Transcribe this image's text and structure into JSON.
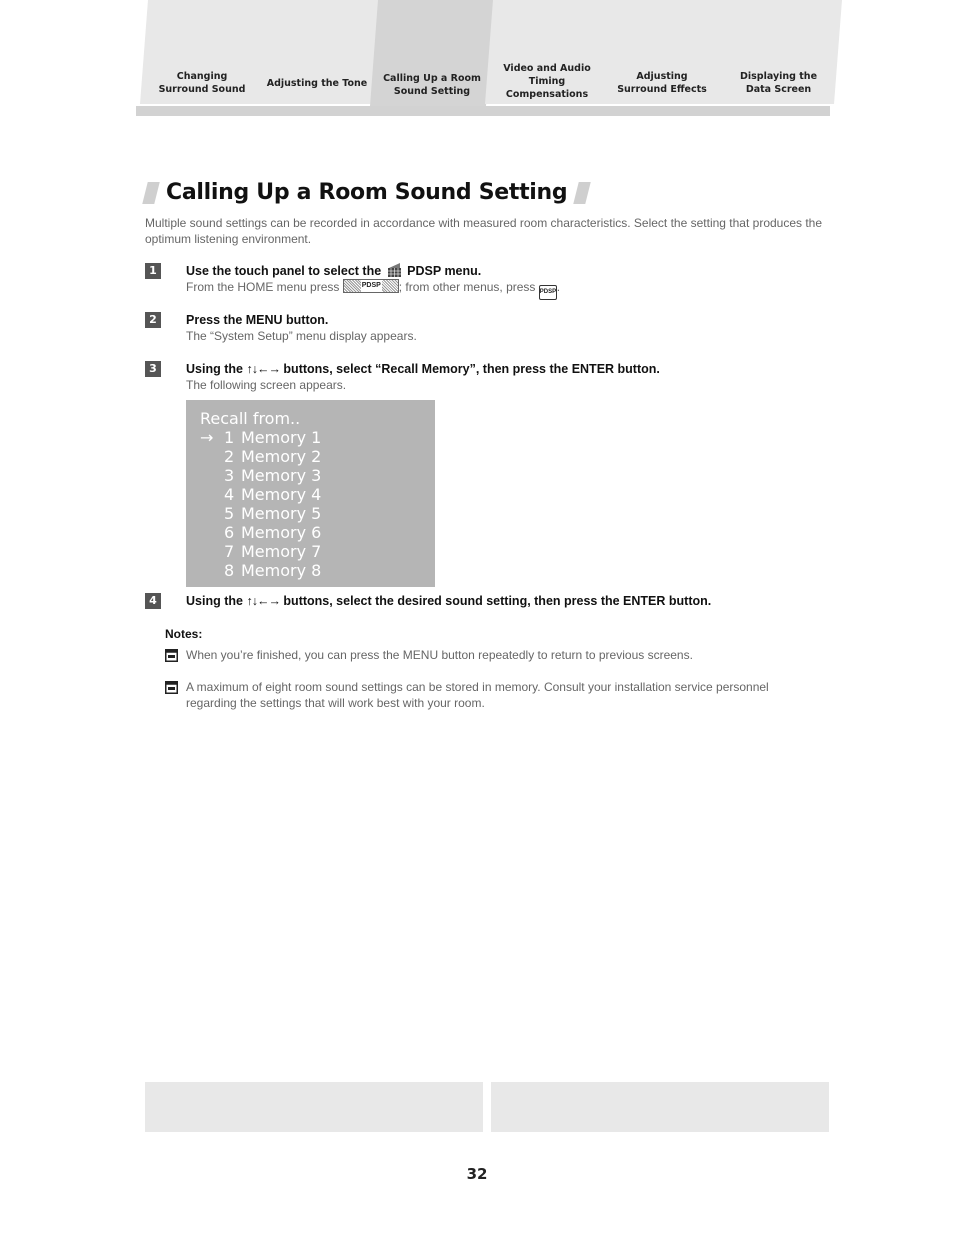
{
  "tabs": [
    {
      "label": "Changing\nSurround Sound",
      "active": false
    },
    {
      "label": "Adjusting the Tone",
      "active": false
    },
    {
      "label": "Calling Up a Room\nSound Setting",
      "active": true
    },
    {
      "label": "Video and Audio\nTiming\nCompensations",
      "active": false
    },
    {
      "label": "Adjusting\nSurround Effects",
      "active": false
    },
    {
      "label": "Displaying the\nData Screen",
      "active": false
    }
  ],
  "heading": "Calling Up a Room Sound Setting",
  "intro": "Multiple sound settings can be recorded in accordance with measured room characteristics. Select the setting that produces the optimum listening environment.",
  "steps": [
    {
      "number": "1",
      "title_pre": "Use the touch panel to select the",
      "title_post": "PDSP menu.",
      "sub_pre": "From the HOME menu press",
      "sub_mid": "; from other menus, press",
      "sub_post": ".",
      "button_wide_label": "PDSP",
      "button_small_label": "PDSP"
    },
    {
      "number": "2",
      "title": "Press the MENU button.",
      "sub": "The “System Setup” menu display appears."
    },
    {
      "number": "3",
      "title_pre": "Using the",
      "arrows": "↑↓←→",
      "title_post": "buttons, select “Recall Memory”, then press the ENTER button.",
      "sub": "The following screen appears."
    },
    {
      "number": "4",
      "title_pre": "Using the",
      "arrows": "↑↓←→",
      "title_post": "buttons, select the desired sound setting, then press the ENTER button."
    }
  ],
  "screen": {
    "title": "Recall from..",
    "cursor": "→",
    "items": [
      {
        "num": "1",
        "label": "Memory 1",
        "selected": true
      },
      {
        "num": "2",
        "label": "Memory 2",
        "selected": false
      },
      {
        "num": "3",
        "label": "Memory 3",
        "selected": false
      },
      {
        "num": "4",
        "label": "Memory 4",
        "selected": false
      },
      {
        "num": "5",
        "label": "Memory 5",
        "selected": false
      },
      {
        "num": "6",
        "label": "Memory 6",
        "selected": false
      },
      {
        "num": "7",
        "label": "Memory 7",
        "selected": false
      },
      {
        "num": "8",
        "label": "Memory 8",
        "selected": false
      }
    ]
  },
  "notes": {
    "label": "Notes:",
    "items": [
      "When you’re finished, you can press the MENU button repeatedly to return to previous screens.",
      "A maximum of eight room sound settings can be stored in memory. Consult your installation service personnel regarding the settings that will work best with your room."
    ]
  },
  "page_number": "32",
  "colors": {
    "tab": "#e8e8e8",
    "tab_active": "#d4d4d4",
    "screen_bg": "#b5b5b5",
    "step_badge": "#555555"
  }
}
